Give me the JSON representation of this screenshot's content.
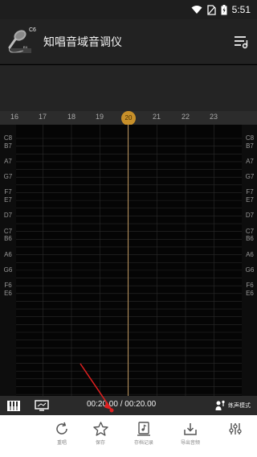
{
  "status_bar": {
    "time": "5:51"
  },
  "header": {
    "logo_top_note": "C6",
    "logo_bottom_note": "E4",
    "title": "知唱音域音调仪"
  },
  "timeline": {
    "ticks": [
      "16",
      "17",
      "18",
      "19",
      "20",
      "21",
      "22",
      "23"
    ],
    "current": "20"
  },
  "chart": {
    "notes": [
      "C8",
      "B7",
      "A7",
      "G7",
      "F7",
      "E7",
      "D7",
      "C7",
      "B6",
      "A6",
      "G6",
      "F6",
      "E6"
    ]
  },
  "player": {
    "time": "00:20.00 / 00:20.00",
    "mode_label": "练声模式"
  },
  "actions": [
    {
      "label": "重唱"
    },
    {
      "label": "保存"
    },
    {
      "label": "存档记录"
    },
    {
      "label": "导出音频"
    },
    {
      "label": ""
    }
  ],
  "colors": {
    "accent": "#c8902a",
    "playhead": "#b9925a",
    "annotation": "#e02020"
  }
}
